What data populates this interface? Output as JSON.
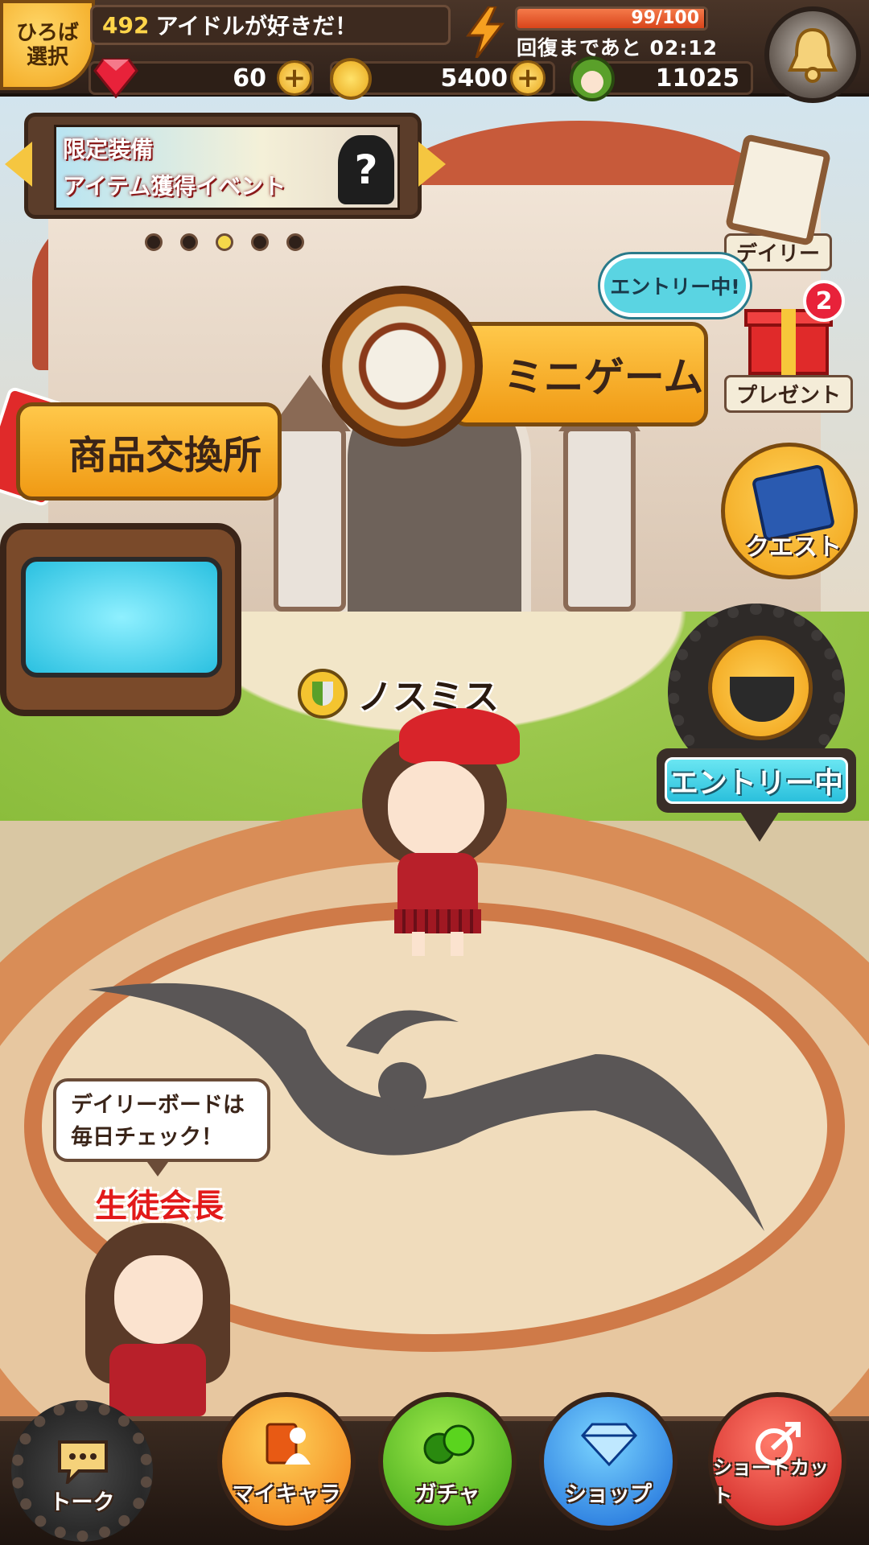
{
  "header": {
    "plaza_select": "ひろば\n選択",
    "room_number": "492",
    "room_title": "アイドルが好きだ！",
    "stamina": {
      "current": 99,
      "max": 100,
      "text": "99/100"
    },
    "recover_text": "回復まであと 02:12",
    "notification_icon": "bell-icon"
  },
  "currencies": {
    "gems": "60",
    "coins": "5400",
    "friends": "11025"
  },
  "banner": {
    "line1": "限定装備",
    "line2": "アイテム獲得イベント",
    "page_count": 5,
    "active_page": 3
  },
  "side": {
    "daily": "デイリー",
    "present": "プレゼント",
    "present_badge": "2",
    "entry_bubble": "エントリー中!",
    "quest": "クエスト"
  },
  "places": {
    "minigame": "ミニゲーム",
    "exchange": "商品交換所",
    "event_entry": "エントリー中"
  },
  "player": {
    "name": "ノスミス"
  },
  "npc": {
    "speech": "デイリーボードは\n毎日チェック！",
    "name": "生徒会長"
  },
  "nav": {
    "talk": "トーク",
    "my_character": "マイキャラ",
    "gacha": "ガチャ",
    "shop": "ショップ",
    "shortcut": "ショートカット"
  },
  "colors": {
    "accent_gold": "#f5c640",
    "badge_red": "#e8223a",
    "entry_cyan": "#5ad4e2",
    "npc_name_red": "#e21a1a"
  }
}
